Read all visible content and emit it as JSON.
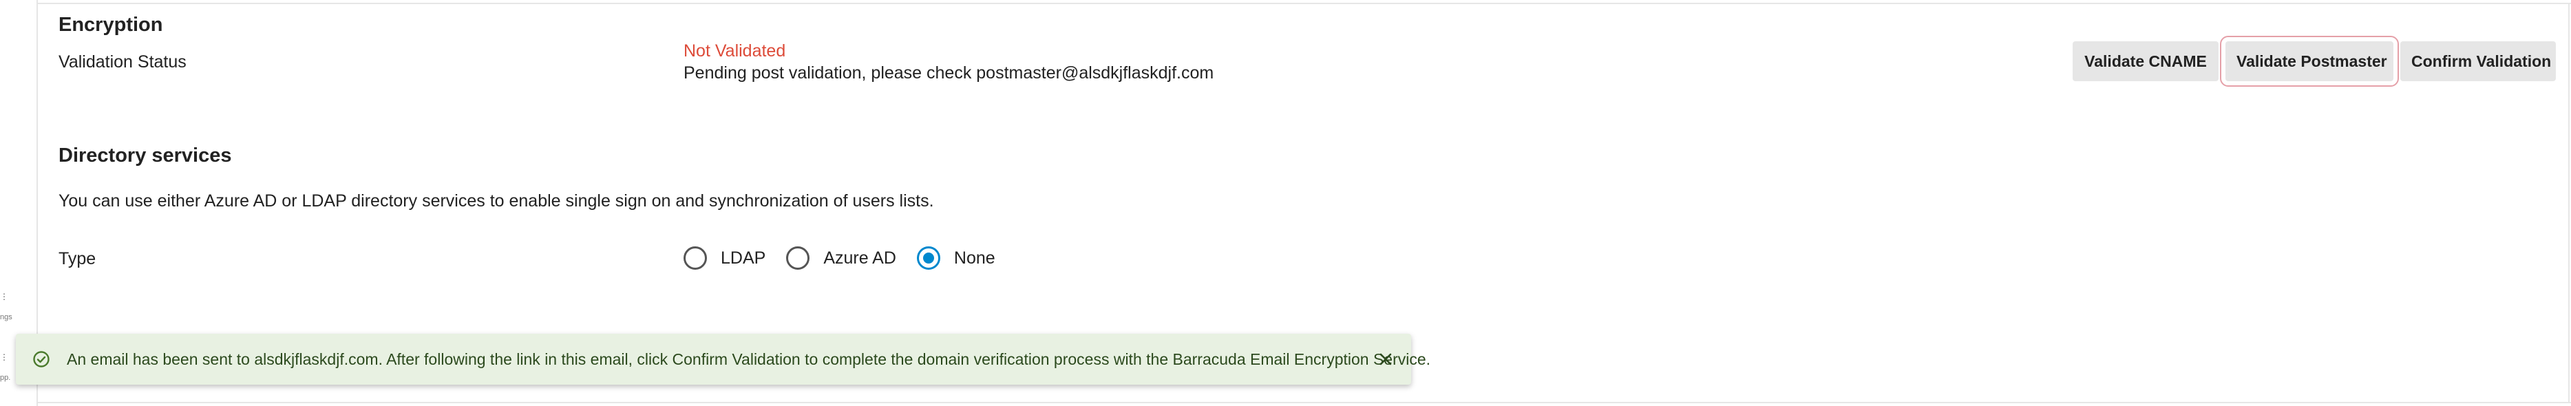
{
  "encryption": {
    "title": "Encryption",
    "validation_label": "Validation Status",
    "status": "Not Validated",
    "status_detail": "Pending post validation, please check postmaster@alsdkjflaskdjf.com",
    "buttons": {
      "validate_cname": "Validate CNAME",
      "validate_postmaster": "Validate Postmaster",
      "confirm_validation": "Confirm Validation"
    }
  },
  "directory": {
    "title": "Directory services",
    "description": "You can use either Azure AD or LDAP directory services to enable single sign on and synchronization of users lists.",
    "type_label": "Type",
    "options": [
      "LDAP",
      "Azure AD",
      "None"
    ],
    "selected": "None"
  },
  "toast": {
    "message": "An email has been sent to alsdkjflaskdjf.com. After following the link in this email, click Confirm Validation to complete the domain verification process with the Barracuda Email Encryption Service."
  },
  "left_rail": {
    "fragment_a": "ngs",
    "fragment_b": "pp."
  },
  "colors": {
    "accent": "#0088ce",
    "error": "#dd4b39",
    "success_bg": "#e8f1e2",
    "success_icon": "#4a7a2c"
  },
  "icons": {
    "toast": "check-circle-icon",
    "close": "close-icon"
  }
}
